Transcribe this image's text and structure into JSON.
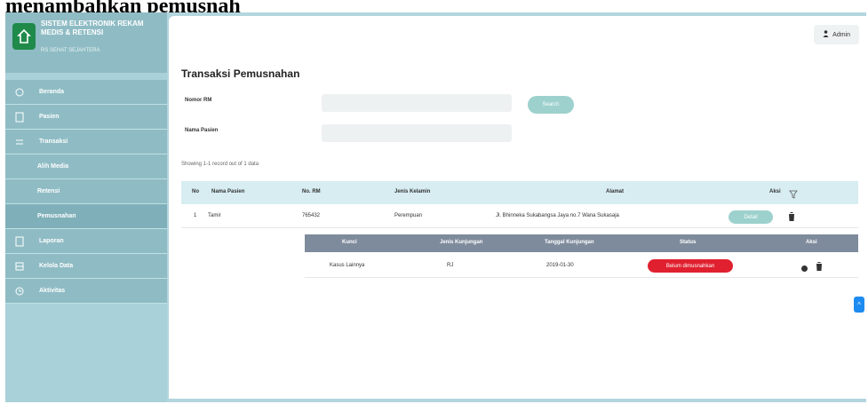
{
  "caption": "menambahkan pemusnah",
  "colors": {
    "accent": "#9dd1cd",
    "sidebar": "#a9d1d9",
    "badge_danger": "#e0202f",
    "scroll_button": "#1e8bf0"
  },
  "brand": {
    "title": "SISTEM ELEKTRONIK REKAM MEDIS & RETENSI",
    "subtitle": "RS SEHAT SEJAHTERA"
  },
  "sidebar": {
    "items": [
      {
        "label": "Beranda",
        "icon": "home-icon"
      },
      {
        "label": "Pasien",
        "icon": "file-icon"
      },
      {
        "label": "Transaksi",
        "icon": "transfer-icon"
      },
      {
        "label": "Alih Media"
      },
      {
        "label": "Retensi"
      },
      {
        "label": "Pemusnahan"
      },
      {
        "label": "Laporan",
        "icon": "report-icon"
      },
      {
        "label": "Kelola Data",
        "icon": "database-icon"
      },
      {
        "label": "Aktivitas",
        "icon": "clock-icon"
      }
    ]
  },
  "header": {
    "user_label": "Admin",
    "user_icon": "user-icon"
  },
  "page": {
    "title": "Transaksi Pemusnahan"
  },
  "form": {
    "rm_label": "Nomor RM",
    "rm_value": "",
    "name_label": "Nama Pasien",
    "name_value": "",
    "search_label": "Search"
  },
  "table": {
    "showing": "Showing 1-1 record out of 1 data",
    "headers": [
      "No",
      "Nama Pasien",
      "No. RM",
      "Jenis Kelamin",
      "Alamat",
      "Aksi"
    ],
    "filter_icon": "filter-icon",
    "row": {
      "no": "1",
      "name": "Tamir",
      "rm": "765432",
      "gender": "Perempuan",
      "address": "Jl. Bhinneka Sukabangsa Jaya no.7 Wana Sukasaja",
      "detail_label": "Detail"
    }
  },
  "visits": {
    "headers": [
      "Kunci",
      "Jenis Kunjungan",
      "Tanggal Kunjungan",
      "Status",
      "Aksi"
    ],
    "row": {
      "kunci": "Kasus Lainnya",
      "jenis": "RJ",
      "tanggal": "2019-01-30",
      "status": "Belum dimusnahkan"
    }
  },
  "scroll_top_label": "^"
}
